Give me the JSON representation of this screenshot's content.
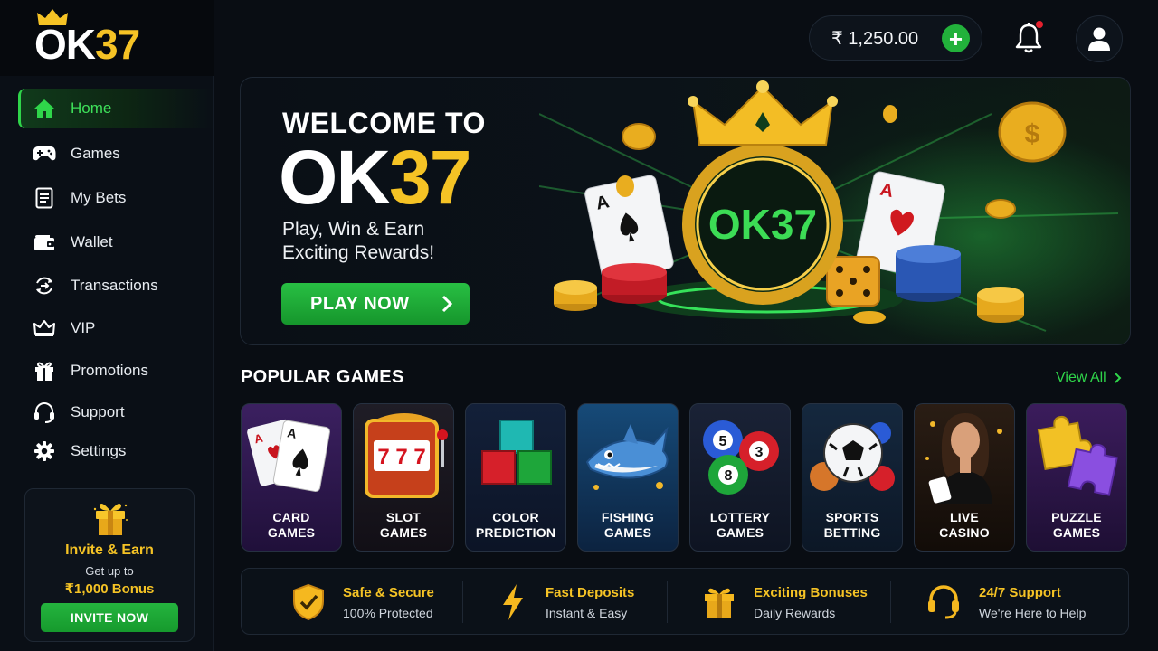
{
  "brand": {
    "logo_ok": "OK",
    "logo_num": "37"
  },
  "nav": {
    "items": [
      {
        "label": "Home",
        "icon": "home-icon",
        "active": true
      },
      {
        "label": "Games",
        "icon": "gamepad-icon"
      },
      {
        "label": "My Bets",
        "icon": "bets-list-icon"
      },
      {
        "label": "Wallet",
        "icon": "wallet-icon"
      },
      {
        "label": "Transactions",
        "icon": "transactions-icon"
      },
      {
        "label": "VIP",
        "icon": "crown-icon"
      },
      {
        "label": "Promotions",
        "icon": "gift-icon"
      },
      {
        "label": "Support",
        "icon": "headset-icon"
      },
      {
        "label": "Settings",
        "icon": "gear-icon"
      }
    ]
  },
  "invite": {
    "title": "Invite & Earn",
    "subtitle": "Get up to",
    "bonus": "₹1,000 Bonus",
    "button": "INVITE NOW"
  },
  "header": {
    "balance": "₹ 1,250.00",
    "add_icon": "plus-icon",
    "notification_icon": "bell-icon",
    "profile_icon": "user-icon"
  },
  "hero": {
    "welcome": "WELCOME TO",
    "brand_ok": "OK",
    "brand_num": "37",
    "tagline_1": "Play, Win & Earn",
    "tagline_2": "Exciting Rewards!",
    "cta": "PLAY NOW",
    "emblem_text": "OK37"
  },
  "popular": {
    "title": "POPULAR GAMES",
    "view_all": "View All",
    "games": [
      {
        "line1": "CARD",
        "line2": "GAMES"
      },
      {
        "line1": "SLOT",
        "line2": "GAMES"
      },
      {
        "line1": "COLOR",
        "line2": "PREDICTION"
      },
      {
        "line1": "FISHING",
        "line2": "GAMES"
      },
      {
        "line1": "LOTTERY",
        "line2": "GAMES"
      },
      {
        "line1": "SPORTS",
        "line2": "BETTING"
      },
      {
        "line1": "LIVE",
        "line2": "CASINO"
      },
      {
        "line1": "PUZZLE",
        "line2": "GAMES"
      }
    ],
    "lottery_balls": [
      "5",
      "3",
      "8"
    ],
    "slot_reels": [
      "7",
      "7",
      "7"
    ]
  },
  "features": [
    {
      "title": "Safe & Secure",
      "subtitle": "100% Protected",
      "icon": "shield-check-icon"
    },
    {
      "title": "Fast Deposits",
      "subtitle": "Instant & Easy",
      "icon": "lightning-icon"
    },
    {
      "title": "Exciting Bonuses",
      "subtitle": "Daily Rewards",
      "icon": "gift-icon"
    },
    {
      "title": "24/7 Support",
      "subtitle": "We're Here to Help",
      "icon": "headset-icon"
    }
  ],
  "colors": {
    "accent_green": "#2fd54a",
    "accent_gold": "#f5c325",
    "background": "#090d13"
  }
}
